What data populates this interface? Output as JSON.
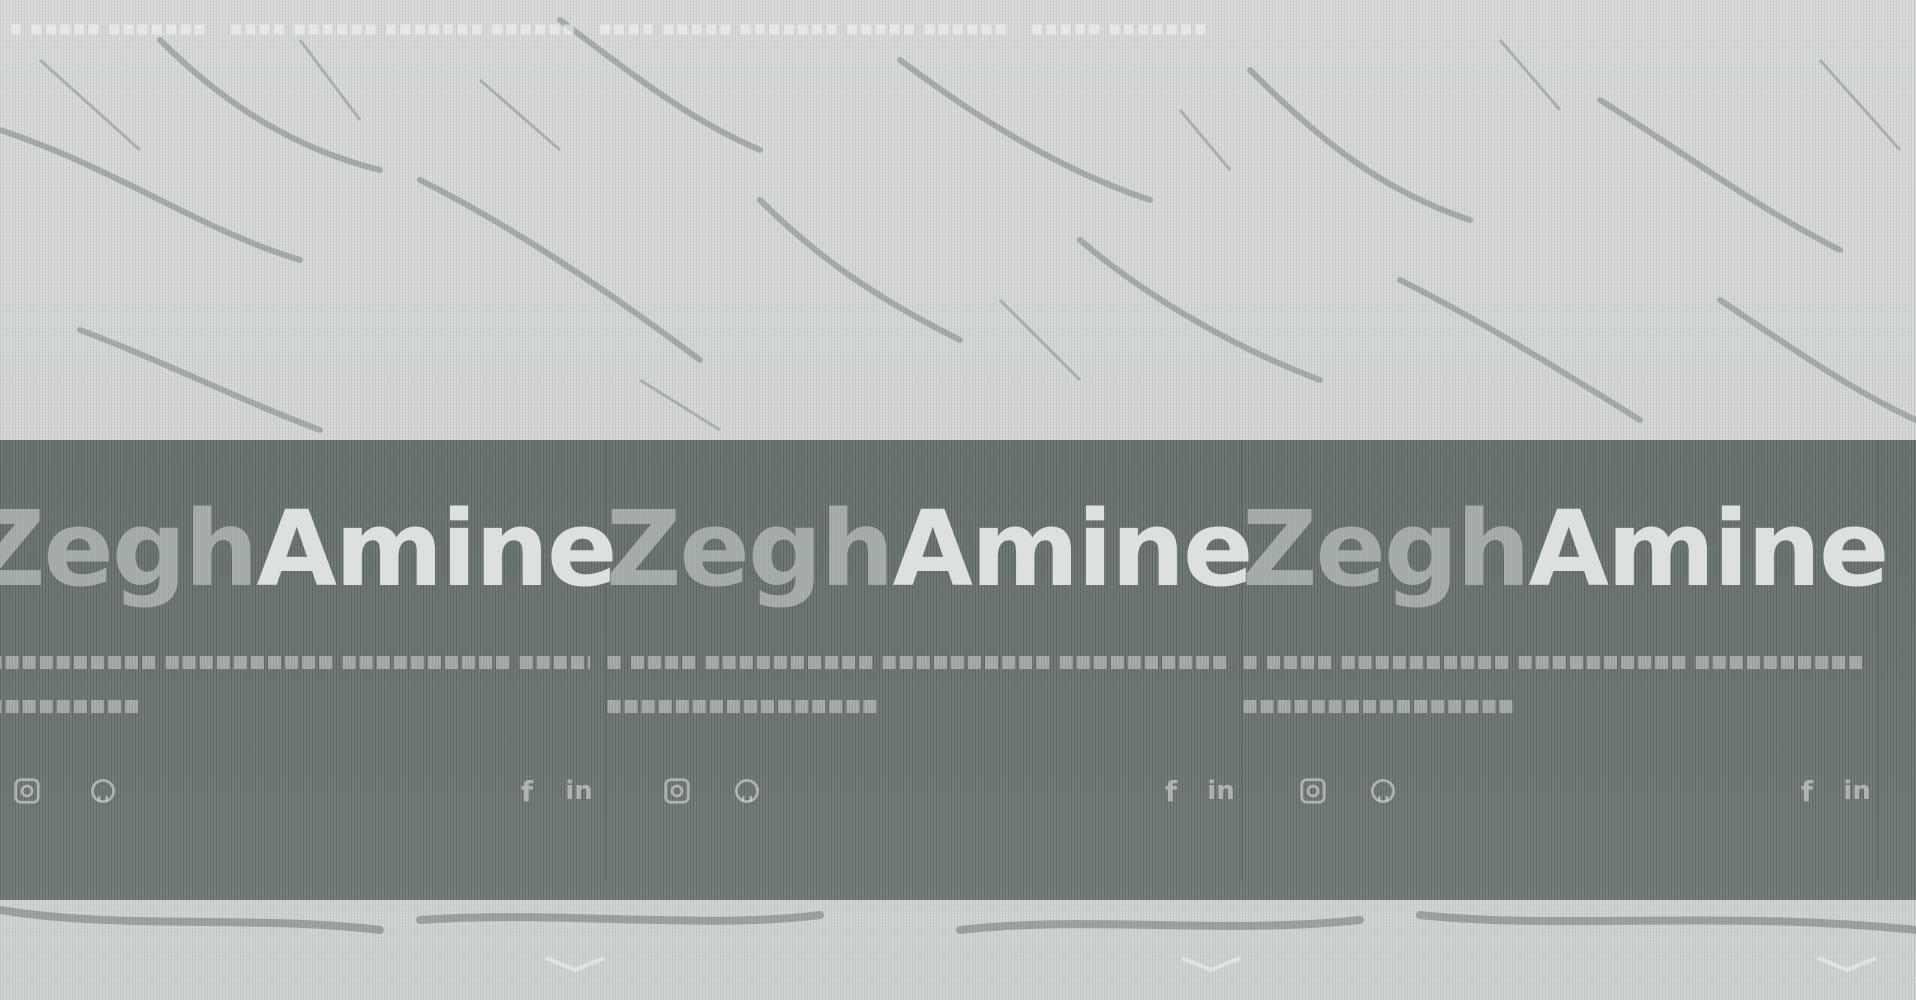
{
  "hero": {
    "panels": [
      {
        "first": "Zegh",
        "last": "Amine"
      },
      {
        "first": "Zegh",
        "last": "Amine"
      },
      {
        "first": "Zegh",
        "last": "Amine"
      }
    ]
  },
  "social": {
    "icons": [
      "facebook-icon",
      "linkedin-icon",
      "instagram-icon",
      "github-icon"
    ],
    "glyphs": {
      "facebook": "f",
      "linkedin": "in"
    }
  },
  "colors": {
    "band": "#5c6560",
    "name_last": "#ecf0ee",
    "name_first": "#d6dcd8",
    "background": "#cfd3cf"
  }
}
